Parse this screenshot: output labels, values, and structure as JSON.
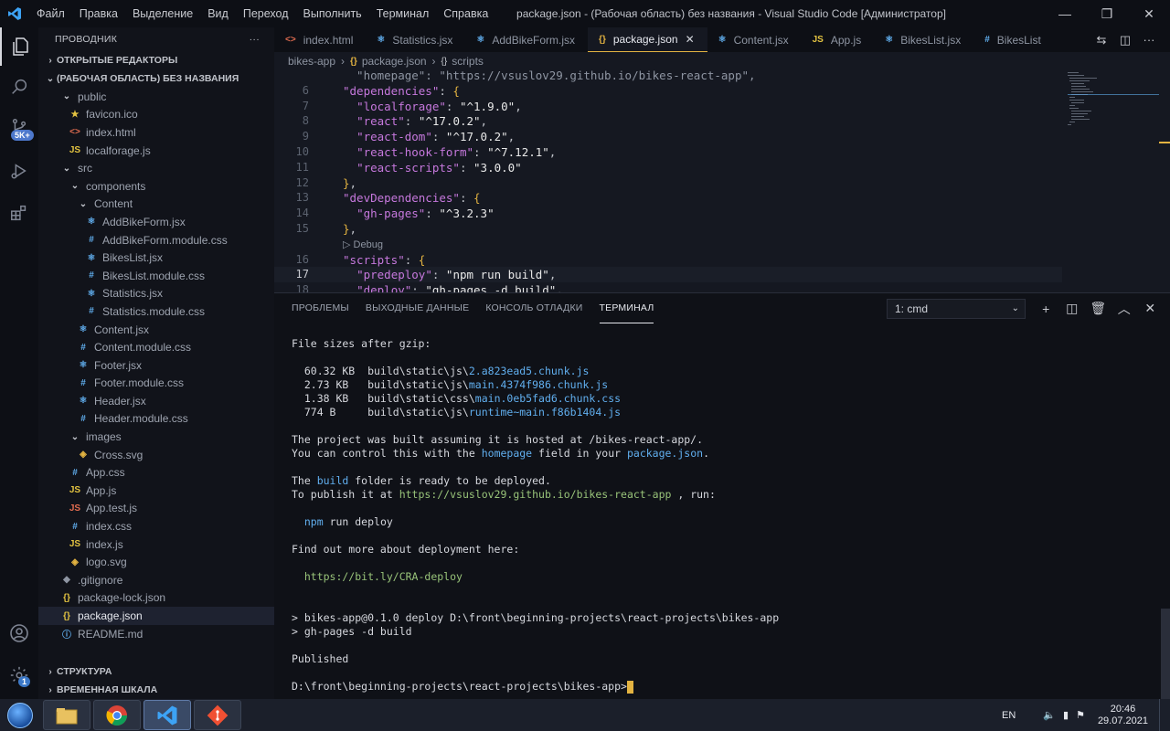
{
  "window": {
    "title": "package.json - (Рабочая область) без названия - Visual Studio Code [Администратор]",
    "menu": [
      "Файл",
      "Правка",
      "Выделение",
      "Вид",
      "Переход",
      "Выполнить",
      "Терминал",
      "Справка"
    ]
  },
  "activity_bar": {
    "source_control_badge": "5K+",
    "settings_badge": "1"
  },
  "sidebar": {
    "header": "ПРОВОДНИК",
    "more": "···",
    "open_editors": "ОТКРЫТЫЕ РЕДАКТОРЫ",
    "workspace": "(РАБОЧАЯ ОБЛАСТЬ) БЕЗ НАЗВАНИЯ",
    "files": [
      {
        "name": "public",
        "icon": "chevron-down",
        "depth": 1,
        "folder": true
      },
      {
        "name": "favicon.ico",
        "icon": "star",
        "depth": 2
      },
      {
        "name": "index.html",
        "icon": "html",
        "depth": 2
      },
      {
        "name": "localforage.js",
        "icon": "js",
        "depth": 2
      },
      {
        "name": "src",
        "icon": "chevron-down",
        "depth": 1,
        "folder": true
      },
      {
        "name": "components",
        "icon": "chevron-down",
        "depth": 2,
        "folder": true
      },
      {
        "name": "Content",
        "icon": "chevron-down",
        "depth": 3,
        "folder": true
      },
      {
        "name": "AddBikeForm.jsx",
        "icon": "react",
        "depth": 4
      },
      {
        "name": "AddBikeForm.module.css",
        "icon": "css",
        "depth": 4
      },
      {
        "name": "BikesList.jsx",
        "icon": "react",
        "depth": 4
      },
      {
        "name": "BikesList.module.css",
        "icon": "css",
        "depth": 4
      },
      {
        "name": "Statistics.jsx",
        "icon": "react",
        "depth": 4
      },
      {
        "name": "Statistics.module.css",
        "icon": "css",
        "depth": 4
      },
      {
        "name": "Content.jsx",
        "icon": "react",
        "depth": 3
      },
      {
        "name": "Content.module.css",
        "icon": "css",
        "depth": 3
      },
      {
        "name": "Footer.jsx",
        "icon": "react",
        "depth": 3
      },
      {
        "name": "Footer.module.css",
        "icon": "css",
        "depth": 3
      },
      {
        "name": "Header.jsx",
        "icon": "react",
        "depth": 3
      },
      {
        "name": "Header.module.css",
        "icon": "css",
        "depth": 3
      },
      {
        "name": "images",
        "icon": "chevron-down",
        "depth": 2,
        "folder": true
      },
      {
        "name": "Cross.svg",
        "icon": "svg",
        "depth": 3
      },
      {
        "name": "App.css",
        "icon": "css",
        "depth": 2
      },
      {
        "name": "App.js",
        "icon": "js",
        "depth": 2
      },
      {
        "name": "App.test.js",
        "icon": "js-test",
        "depth": 2
      },
      {
        "name": "index.css",
        "icon": "css",
        "depth": 2
      },
      {
        "name": "index.js",
        "icon": "js",
        "depth": 2
      },
      {
        "name": "logo.svg",
        "icon": "svg",
        "depth": 2
      },
      {
        "name": ".gitignore",
        "icon": "git",
        "depth": 1
      },
      {
        "name": "package-lock.json",
        "icon": "json",
        "depth": 1
      },
      {
        "name": "package.json",
        "icon": "json",
        "depth": 1,
        "selected": true
      },
      {
        "name": "README.md",
        "icon": "info",
        "depth": 1
      }
    ],
    "structure": "СТРУКТУРА",
    "timeline": "ВРЕМЕННАЯ ШКАЛА"
  },
  "tabs": [
    {
      "label": "index.html",
      "icon": "<>",
      "color": "#e06c50"
    },
    {
      "label": "Statistics.jsx",
      "icon": "⚛",
      "color": "#61afef"
    },
    {
      "label": "AddBikeForm.jsx",
      "icon": "⚛",
      "color": "#61afef"
    },
    {
      "label": "package.json",
      "icon": "{}",
      "color": "#e3b341",
      "active": true
    },
    {
      "label": "Content.jsx",
      "icon": "⚛",
      "color": "#61afef"
    },
    {
      "label": "App.js",
      "icon": "JS",
      "color": "#e3c341"
    },
    {
      "label": "BikesList.jsx",
      "icon": "⚛",
      "color": "#61afef"
    },
    {
      "label": "BikesList",
      "icon": "#",
      "color": "#61afef"
    }
  ],
  "breadcrumb": {
    "folder": "bikes-app",
    "file": "package.json",
    "node": "scripts"
  },
  "editor": {
    "lines": [
      {
        "n": "",
        "text": "  \"homepage\": \"https://vsuslov29.github.io/bikes-react-app\","
      },
      {
        "n": "6",
        "key": "dependencies",
        "indent": 1,
        "open": "{"
      },
      {
        "n": "7",
        "key": "localforage",
        "val": "^1.9.0",
        "indent": 2
      },
      {
        "n": "8",
        "key": "react",
        "val": "^17.0.2",
        "indent": 2
      },
      {
        "n": "9",
        "key": "react-dom",
        "val": "^17.0.2",
        "indent": 2
      },
      {
        "n": "10",
        "key": "react-hook-form",
        "val": "^7.12.1",
        "indent": 2
      },
      {
        "n": "11",
        "key": "react-scripts",
        "val": "3.0.0",
        "indent": 2,
        "last": true
      },
      {
        "n": "12",
        "close": "},",
        "indent": 1
      },
      {
        "n": "13",
        "key": "devDependencies",
        "indent": 1,
        "open": "{"
      },
      {
        "n": "14",
        "key": "gh-pages",
        "val": "^3.2.3",
        "indent": 2,
        "last": true
      },
      {
        "n": "15",
        "close": "},",
        "indent": 1
      },
      {
        "n": "16",
        "key": "scripts",
        "indent": 1,
        "open": "{"
      },
      {
        "n": "17",
        "key": "predeploy",
        "val": "npm run build",
        "indent": 2,
        "current": true
      },
      {
        "n": "18",
        "key": "deploy",
        "val": "gh-pages -d build",
        "indent": 2
      }
    ],
    "codelens": "▷ Debug"
  },
  "panel": {
    "tabs": [
      "ПРОБЛЕМЫ",
      "ВЫХОДНЫЕ ДАННЫЕ",
      "КОНСОЛЬ ОТЛАДКИ",
      "ТЕРМИНАЛ"
    ],
    "active_tab": "ТЕРМИНАЛ",
    "terminal_select": "1: cmd"
  },
  "terminal": {
    "lines": [
      "File sizes after gzip:",
      "",
      "  60.32 KB  build\\static\\js\\2.a823ead5.chunk.js",
      "  2.73 KB   build\\static\\js\\main.4374f986.chunk.js",
      "  1.38 KB   build\\static\\css\\main.0eb5fad6.chunk.css",
      "  774 B     build\\static\\js\\runtime~main.f86b1404.js",
      "",
      "The project was built assuming it is hosted at /bikes-react-app/.",
      "You can control this with the homepage field in your package.json.",
      "",
      "The build folder is ready to be deployed.",
      "To publish it at https://vsuslov29.github.io/bikes-react-app , run:",
      "",
      "  npm run deploy",
      "",
      "Find out more about deployment here:",
      "",
      "  https://bit.ly/CRA-deploy",
      "",
      "",
      "> bikes-app@0.1.0 deploy D:\\front\\beginning-projects\\react-projects\\bikes-app",
      "> gh-pages -d build",
      "",
      "Published",
      "",
      "D:\\front\\beginning-projects\\react-projects\\bikes-app>"
    ]
  },
  "taskbar": {
    "lang": "EN",
    "time": "20:46",
    "date": "29.07.2021"
  }
}
